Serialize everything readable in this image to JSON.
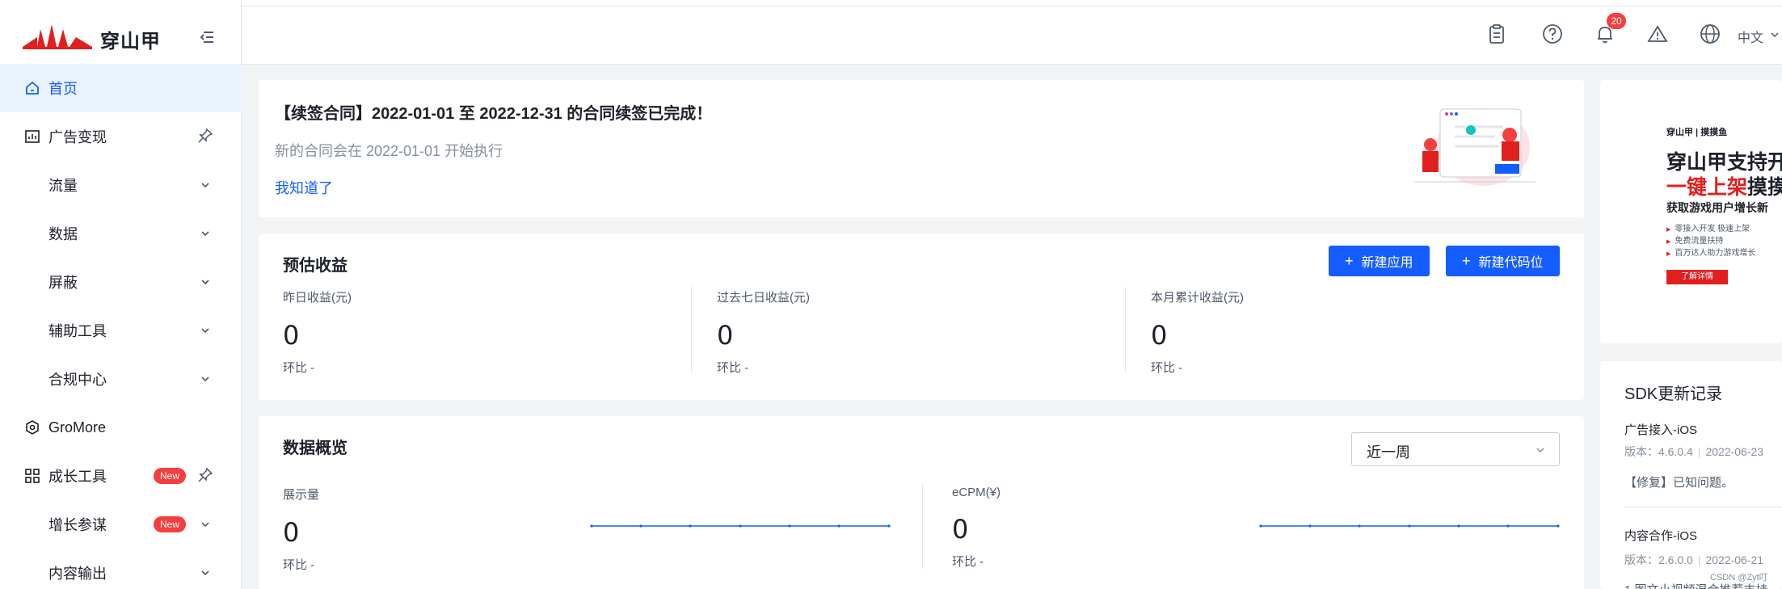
{
  "brand": {
    "logo_text": "穿山甲"
  },
  "sidebar": {
    "items": [
      {
        "label": "首页",
        "icon": "home-icon",
        "active": true
      },
      {
        "label": "广告变现",
        "icon": "chart-icon",
        "pinned": true
      },
      {
        "label": "流量",
        "sub": true
      },
      {
        "label": "数据",
        "sub": true
      },
      {
        "label": "屏蔽",
        "sub": true
      },
      {
        "label": "辅助工具",
        "sub": true
      },
      {
        "label": "合规中心",
        "sub": true
      },
      {
        "label": "GroMore",
        "icon": "hexagon-icon"
      },
      {
        "label": "成长工具",
        "icon": "grid-icon",
        "badge": "New",
        "pinned": true
      },
      {
        "label": "增长参谋",
        "sub": true,
        "badge": "New"
      },
      {
        "label": "内容输出",
        "sub": true
      }
    ]
  },
  "header": {
    "notification_count": "20",
    "language": "中文"
  },
  "notice": {
    "title": "【续签合同】2022-01-01 至 2022-12-31 的合同续签已完成！",
    "desc": "新的合同会在 2022-01-01 开始执行",
    "link": "我知道了"
  },
  "income": {
    "title": "预估收益",
    "btn_new_app": "新建应用",
    "btn_new_slot": "新建代码位",
    "metrics": [
      {
        "label": "昨日收益(元)",
        "value": "0",
        "ratio": "环比 -"
      },
      {
        "label": "过去七日收益(元)",
        "value": "0",
        "ratio": "环比 -"
      },
      {
        "label": "本月累计收益(元)",
        "value": "0",
        "ratio": "环比 -"
      }
    ]
  },
  "overview": {
    "title": "数据概览",
    "period": "近一周",
    "metrics": [
      {
        "label": "展示量",
        "value": "0",
        "ratio": "环比 -"
      },
      {
        "label": "eCPM(¥)",
        "value": "0",
        "ratio": "环比 -"
      }
    ]
  },
  "ad": {
    "brand": "穿山甲 | 摸摸鱼",
    "title1": "穿山甲支持开",
    "title2_red": "一键上架",
    "title2_dark": "摸摸",
    "subtitle": "获取游戏用户增长新",
    "bullets": [
      "零接入开发 极速上架",
      "免费流量扶持",
      "百万达人助力游戏增长"
    ],
    "button": "了解详情"
  },
  "sdk": {
    "title": "SDK更新记录",
    "items": [
      {
        "name": "广告接入-iOS",
        "version": "版本：4.6.0.4",
        "date": "2022-06-23",
        "desc": "【修复】已知问题。"
      },
      {
        "name": "内容合作-iOS",
        "version": "版本：2.6.0.0",
        "date": "2022-06-21",
        "desc": "1.图文小视频混合推荐支持"
      }
    ]
  },
  "watermark": "CSDN @Zyt叮",
  "colors": {
    "primary": "#165dff",
    "danger": "#f53f3f",
    "brand_red": "#e0201e"
  }
}
